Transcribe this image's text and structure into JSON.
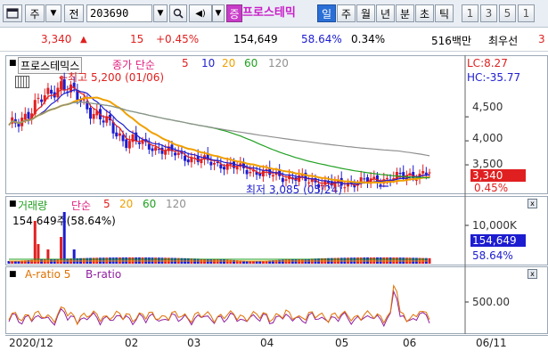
{
  "toolbar": {
    "btn_type": "주",
    "btn_prev": "전",
    "code": "203690",
    "stock_tag": "증",
    "stock_name": "프로스테믹",
    "periods": [
      "일",
      "주",
      "월",
      "년",
      "분",
      "초",
      "틱"
    ],
    "numbers": [
      "1",
      "3",
      "5",
      "1"
    ]
  },
  "quote": {
    "price": "3,340",
    "change": "15",
    "change_pct": "+0.45%",
    "volume": "154,649",
    "vol_ratio": "58.64%",
    "turnover": "0.34%",
    "amount": "516백만",
    "note": "최우선",
    "cut": "3"
  },
  "price_panel": {
    "name": "프로스테믹스",
    "ma_label": "종가 단순",
    "ma_periods": [
      "5",
      "10",
      "20",
      "60",
      "120"
    ],
    "high_label": "←최고 5,200 (01/06)",
    "low_label": "최저 3,085 (05/24)",
    "lc": "LC:8.27",
    "hc": "HC:-35.77",
    "yticks": [
      "4,500",
      "4,000",
      "3,500"
    ],
    "price_tag": "3,340",
    "pct_tag": "0.45%",
    "colors": {
      "up": "#e02020",
      "down": "#1c1cd0",
      "ma5": "#e02020",
      "ma10": "#2020d0",
      "ma20": "#f0a000",
      "ma60": "#20a020",
      "ma120": "#909090"
    }
  },
  "volume_panel": {
    "title": "거래량",
    "ma_label": "단순",
    "ma_periods": [
      "5",
      "20",
      "60",
      "120"
    ],
    "value_line": "154,649주(58.64%)",
    "ytick": "10,000K",
    "vol_tag": "154,649",
    "ratio_tag": "58.64%"
  },
  "ratio_panel": {
    "a_label": "A-ratio 5",
    "b_label": "B-ratio",
    "ytick": "500.00"
  },
  "dates": [
    "2020/12",
    "02",
    "03",
    "04",
    "05",
    "06",
    "06/11"
  ],
  "chart_data": {
    "type": "line",
    "title": "",
    "x": [
      "2020/12",
      "01/06",
      "02",
      "03",
      "04",
      "05/24",
      "06",
      "06/11"
    ],
    "series": [
      {
        "name": "종가",
        "values": [
          4250,
          5200,
          4050,
          3650,
          3300,
          3085,
          3200,
          3340
        ]
      },
      {
        "name": "A-ratio 5",
        "values": [
          150,
          300,
          120,
          80,
          150,
          260,
          560,
          200
        ]
      },
      {
        "name": "B-ratio",
        "values": [
          120,
          240,
          100,
          90,
          130,
          220,
          480,
          180
        ]
      }
    ],
    "ylim_price": [
      3000,
      5300
    ],
    "ylim_ratio": [
      0,
      700
    ]
  }
}
